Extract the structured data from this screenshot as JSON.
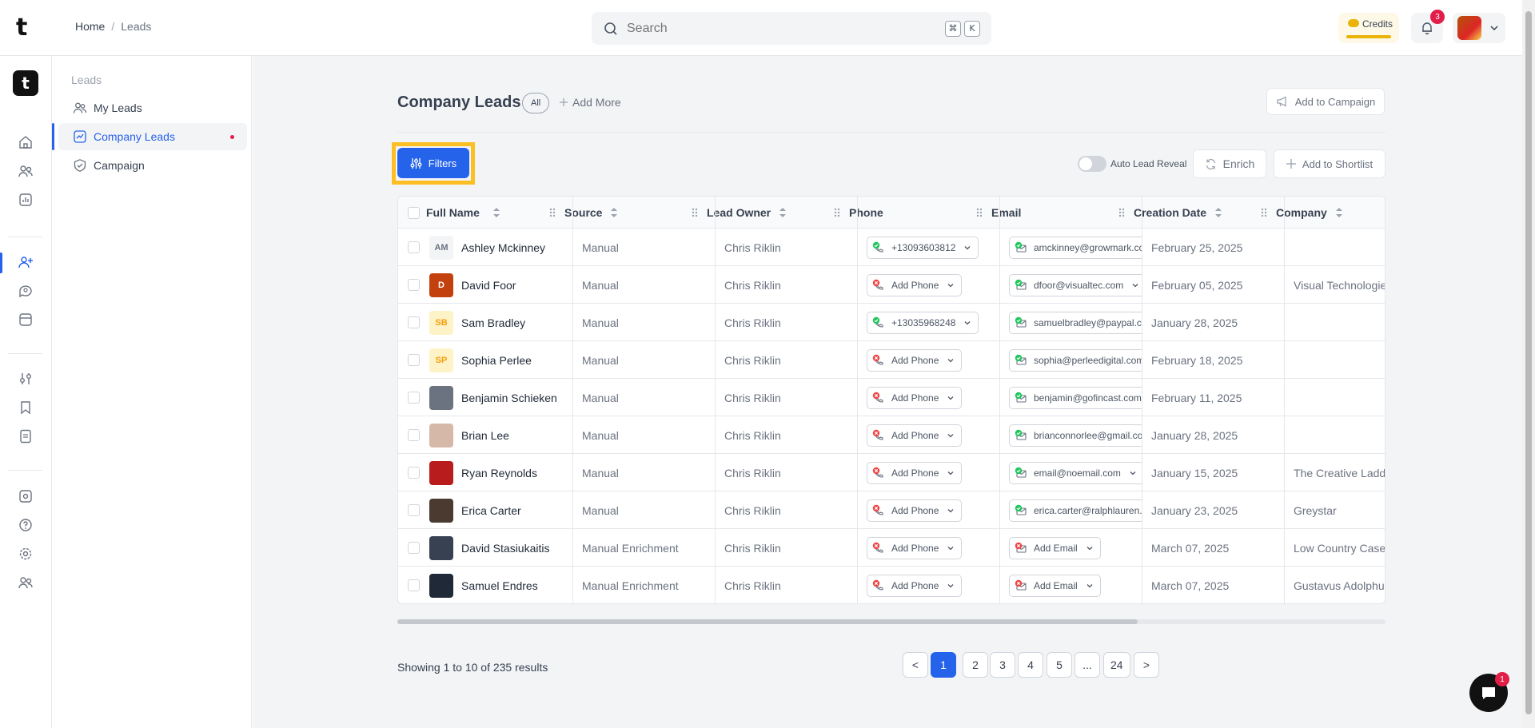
{
  "topbar": {
    "brand": "t",
    "breadcrumb": {
      "home": "Home",
      "separator": "/",
      "current": "Leads"
    },
    "search": {
      "placeholder": "Search",
      "shortcut_mod": "⌘",
      "shortcut_key": "K"
    },
    "credits_label": "Credits",
    "notifications_count": "3"
  },
  "rail": {
    "logo": "t"
  },
  "subnav": {
    "heading": "Leads",
    "items": [
      {
        "label": "My Leads",
        "icon": "users-icon"
      },
      {
        "label": "Company Leads",
        "icon": "chart-square-icon"
      },
      {
        "label": "Campaign",
        "icon": "shield-check-icon"
      }
    ]
  },
  "page": {
    "title": "Company Leads",
    "filter_pill": "All",
    "add_more": "Add More",
    "add_to_campaign": "Add to Campaign",
    "filters_button": "Filters",
    "auto_lead_reveal": "Auto Lead Reveal",
    "enrich": "Enrich",
    "add_to_shortlist": "Add to Shortlist"
  },
  "table": {
    "columns": [
      "Full Name",
      "Source",
      "Lead Owner",
      "Phone",
      "Email",
      "Creation Date",
      "Company"
    ],
    "rows": [
      {
        "initials": "AM",
        "avatar_bg": "#f3f4f6",
        "avatar_fg": "#6b7280",
        "name": "Ashley Mckinney",
        "source": "Manual",
        "owner": "Chris Riklin",
        "phone": "+13093603812",
        "phone_ok": true,
        "email": "amckinney@growmark.com",
        "email_ok": true,
        "date": "February 25, 2025",
        "company": ""
      },
      {
        "initials": "D",
        "avatar_bg": "#c2410c",
        "avatar_fg": "#ffffff",
        "name": "David Foor",
        "source": "Manual",
        "owner": "Chris Riklin",
        "phone": "Add Phone",
        "phone_ok": false,
        "email": "dfoor@visualtec.com",
        "email_ok": true,
        "date": "February 05, 2025",
        "company": "Visual Technologies"
      },
      {
        "initials": "SB",
        "avatar_bg": "#fef3c7",
        "avatar_fg": "#f59e0b",
        "name": "Sam Bradley",
        "source": "Manual",
        "owner": "Chris Riklin",
        "phone": "+13035968248",
        "phone_ok": true,
        "email": "samuelbradley@paypal.com",
        "email_ok": true,
        "date": "January 28, 2025",
        "company": ""
      },
      {
        "initials": "SP",
        "avatar_bg": "#fef3c7",
        "avatar_fg": "#f59e0b",
        "name": "Sophia Perlee",
        "source": "Manual",
        "owner": "Chris Riklin",
        "phone": "Add Phone",
        "phone_ok": false,
        "email": "sophia@perleedigital.com",
        "email_ok": true,
        "date": "February 18, 2025",
        "company": ""
      },
      {
        "initials": "",
        "avatar_bg": "#6b7280",
        "avatar_fg": "#ffffff",
        "name": "Benjamin Schieken",
        "source": "Manual",
        "owner": "Chris Riklin",
        "phone": "Add Phone",
        "phone_ok": false,
        "email": "benjamin@gofincast.com",
        "email_ok": true,
        "date": "February 11, 2025",
        "company": ""
      },
      {
        "initials": "",
        "avatar_bg": "#d6b8a8",
        "avatar_fg": "#ffffff",
        "name": "Brian Lee",
        "source": "Manual",
        "owner": "Chris Riklin",
        "phone": "Add Phone",
        "phone_ok": false,
        "email": "brianconnorlee@gmail.com",
        "email_ok": true,
        "date": "January 28, 2025",
        "company": ""
      },
      {
        "initials": "",
        "avatar_bg": "#b91c1c",
        "avatar_fg": "#ffffff",
        "name": "Ryan Reynolds",
        "source": "Manual",
        "owner": "Chris Riklin",
        "phone": "Add Phone",
        "phone_ok": false,
        "email": "email@noemail.com",
        "email_ok": true,
        "date": "January 15, 2025",
        "company": "The Creative Ladder"
      },
      {
        "initials": "",
        "avatar_bg": "#4b3a2f",
        "avatar_fg": "#ffffff",
        "name": "Erica Carter",
        "source": "Manual",
        "owner": "Chris Riklin",
        "phone": "Add Phone",
        "phone_ok": false,
        "email": "erica.carter@ralphlauren.com",
        "email_ok": true,
        "date": "January 23, 2025",
        "company": "Greystar"
      },
      {
        "initials": "",
        "avatar_bg": "#374151",
        "avatar_fg": "#ffffff",
        "name": "David Stasiukaitis",
        "source": "Manual Enrichment",
        "owner": "Chris Riklin",
        "phone": "Add Phone",
        "phone_ok": false,
        "email": "Add Email",
        "email_ok": false,
        "date": "March 07, 2025",
        "company": "Low Country Case"
      },
      {
        "initials": "",
        "avatar_bg": "#1f2937",
        "avatar_fg": "#ffffff",
        "name": "Samuel Endres",
        "source": "Manual Enrichment",
        "owner": "Chris Riklin",
        "phone": "Add Phone",
        "phone_ok": false,
        "email": "Add Email",
        "email_ok": false,
        "date": "March 07, 2025",
        "company": "Gustavus Adolphus"
      }
    ]
  },
  "pagination": {
    "showing": "Showing 1 to 10 of 235 results",
    "prev": "<",
    "next": ">",
    "pages": [
      "1",
      "2",
      "3",
      "4",
      "5",
      "...",
      "24"
    ],
    "current": "1"
  },
  "chat_badge": "1",
  "colors": {
    "accent": "#2563eb",
    "highlight": "#fbbf24",
    "ok": "#22c55e",
    "error": "#ef4444"
  }
}
